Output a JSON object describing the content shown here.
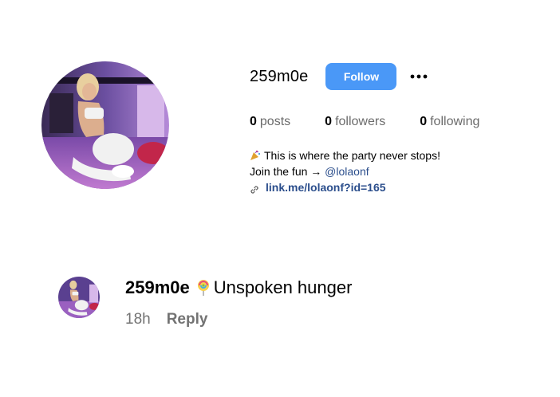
{
  "profile": {
    "username": "259m0e",
    "follow_label": "Follow",
    "more_icon": "more-dots-icon",
    "stats": [
      {
        "count": "0",
        "label": "posts"
      },
      {
        "count": "0",
        "label": "followers"
      },
      {
        "count": "0",
        "label": "following"
      }
    ],
    "bio": {
      "line1_icon": "party-popper-icon",
      "line1": "This is where the party never stops!",
      "line2_prefix": "Join the fun → ",
      "line2_mention": "@lolaonf",
      "link_icon": "link-icon",
      "link_text": "link.me/lolaonf?id=165"
    }
  },
  "comment": {
    "author": "259m0e",
    "emoji_icon": "lollipop-icon",
    "text": "Unspoken hunger",
    "time": "18h",
    "reply_label": "Reply"
  },
  "colors": {
    "follow_button": "#4a98f7",
    "link": "#2b4e8c",
    "muted": "#737373"
  }
}
